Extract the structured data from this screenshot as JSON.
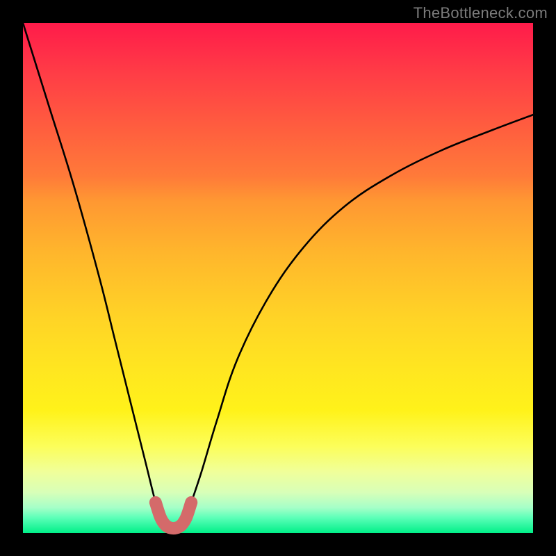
{
  "watermark": "TheBottleneck.com",
  "chart_data": {
    "type": "line",
    "title": "",
    "xlabel": "",
    "ylabel": "",
    "xlim": [
      0,
      100
    ],
    "ylim": [
      0,
      100
    ],
    "grid": false,
    "series": [
      {
        "name": "bottleneck-curve",
        "color": "#000000",
        "x": [
          0,
          5,
          10,
          15,
          18,
          21,
          24,
          26,
          27,
          28,
          29,
          30,
          31,
          32,
          33,
          35,
          38,
          42,
          48,
          55,
          63,
          72,
          82,
          92,
          100
        ],
        "y": [
          100,
          84,
          68,
          50,
          38,
          26,
          14,
          6,
          3,
          1.5,
          1,
          1,
          1.5,
          3,
          6,
          12,
          22,
          34,
          46,
          56,
          64,
          70,
          75,
          79,
          82
        ]
      },
      {
        "name": "valley-marker",
        "color": "#d46a6a",
        "x": [
          26,
          27,
          28,
          29,
          30,
          31,
          32,
          33
        ],
        "y": [
          6,
          3,
          1.5,
          1,
          1,
          1.5,
          3,
          6
        ]
      }
    ]
  }
}
